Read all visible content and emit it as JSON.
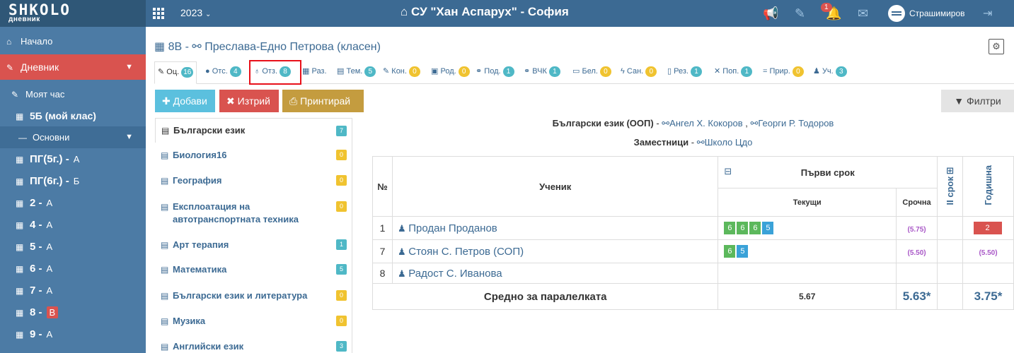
{
  "logo": {
    "brand": "SHKOLO",
    "sub": "дневник"
  },
  "topbar": {
    "year": "2023",
    "school": "СУ \"Хан Аспарух\" - София",
    "notifications": "1",
    "username": "Страшимиров"
  },
  "sidebar": {
    "home": "Начало",
    "diary": "Дневник",
    "my_hour": "Моят час",
    "my_class": "5Б (мой клас)",
    "main_section": "Основни",
    "classes": [
      {
        "name": "ПГ(5г.) -",
        "suffix": "А"
      },
      {
        "name": "ПГ(6г.) -",
        "suffix": "Б"
      },
      {
        "name": "2 -",
        "suffix": "А"
      },
      {
        "name": "4 -",
        "suffix": "А"
      },
      {
        "name": "5 -",
        "suffix": "А"
      },
      {
        "name": "6 -",
        "suffix": "А"
      },
      {
        "name": "7 -",
        "suffix": "А"
      },
      {
        "name": "8 -",
        "suffix": "В"
      },
      {
        "name": "9 -",
        "suffix": "А"
      }
    ]
  },
  "header": {
    "class_name": "8В",
    "teacher": "Преслава-Едно Петрова (класен)"
  },
  "tabs": [
    {
      "label": "Оц.",
      "count": "16",
      "icon": "pencil-icon",
      "color": "b"
    },
    {
      "label": "Отс.",
      "count": "4",
      "icon": "info-icon",
      "color": "b"
    },
    {
      "label": "Отз.",
      "count": "8",
      "icon": "award-icon",
      "color": "b"
    },
    {
      "label": "Раз.",
      "count": "",
      "icon": "table-icon",
      "color": "b"
    },
    {
      "label": "Тем.",
      "count": "5",
      "icon": "book-icon",
      "color": "b"
    },
    {
      "label": "Кон.",
      "count": "0",
      "icon": "edit-icon",
      "color": "y"
    },
    {
      "label": "Род.",
      "count": "0",
      "icon": "calendar-icon",
      "color": "y"
    },
    {
      "label": "Под.",
      "count": "1",
      "icon": "handshake-icon",
      "color": "b"
    },
    {
      "label": "ВЧК",
      "count": "1",
      "icon": "handshake-icon",
      "color": "b"
    },
    {
      "label": "Бел.",
      "count": "0",
      "icon": "comment-icon",
      "color": "y"
    },
    {
      "label": "Сан.",
      "count": "0",
      "icon": "bolt-icon",
      "color": "y"
    },
    {
      "label": "Рез.",
      "count": "1",
      "icon": "file-icon",
      "color": "b"
    },
    {
      "label": "Поп.",
      "count": "1",
      "icon": "tools-icon",
      "color": "b"
    },
    {
      "label": "Прир.",
      "count": "0",
      "icon": "equals-icon",
      "color": "y"
    },
    {
      "label": "Уч.",
      "count": "3",
      "icon": "student-icon",
      "color": "b"
    }
  ],
  "buttons": {
    "add": "Добави",
    "delete": "Изтрий",
    "print": "Принтирай",
    "filter": "Филтри"
  },
  "subjects": [
    {
      "name": "Български език",
      "count": "7",
      "color": "b"
    },
    {
      "name": "Биология16",
      "count": "0",
      "color": "y"
    },
    {
      "name": "География",
      "count": "0",
      "color": "y"
    },
    {
      "name": "Експлоатация на автотранспортната техника",
      "count": "0",
      "color": "y"
    },
    {
      "name": "Арт терапия",
      "count": "1",
      "color": "b"
    },
    {
      "name": "Математика",
      "count": "5",
      "color": "b"
    },
    {
      "name": "Български език и литература",
      "count": "0",
      "color": "y"
    },
    {
      "name": "Музика",
      "count": "0",
      "color": "y"
    },
    {
      "name": "Английски език",
      "count": "3",
      "color": "b"
    }
  ],
  "subject_info": {
    "title": "Български език (ООП)",
    "teacher1": "Ангел Х. Кокоров",
    "teacher2": "Георги Р. Тодоров",
    "substitutes_label": "Заместници",
    "substitute": "Школо Цдо"
  },
  "table": {
    "col_no": "№",
    "col_student": "Ученик",
    "term1": "Първи срок",
    "current": "Текущи",
    "term_grade": "Срочна",
    "term2": "II срок",
    "annual": "Годишна",
    "rows": [
      {
        "no": "1",
        "name": "Продан Проданов",
        "grades": [
          "6",
          "6",
          "6",
          "5"
        ],
        "term": "(5.75)",
        "annual": "2",
        "annual_type": "grade"
      },
      {
        "no": "7",
        "name": "Стоян С. Петров (СОП)",
        "grades": [
          "6",
          "5"
        ],
        "term": "(5.50)",
        "annual": "(5.50)",
        "annual_type": "avg"
      },
      {
        "no": "8",
        "name": "Радост С. Иванова",
        "grades": [],
        "term": "",
        "annual": "",
        "annual_type": "none"
      }
    ],
    "avg_label": "Средно за паралелката",
    "avg_current": "5.67",
    "avg_term": "5.63*",
    "avg_annual": "3.75*"
  }
}
